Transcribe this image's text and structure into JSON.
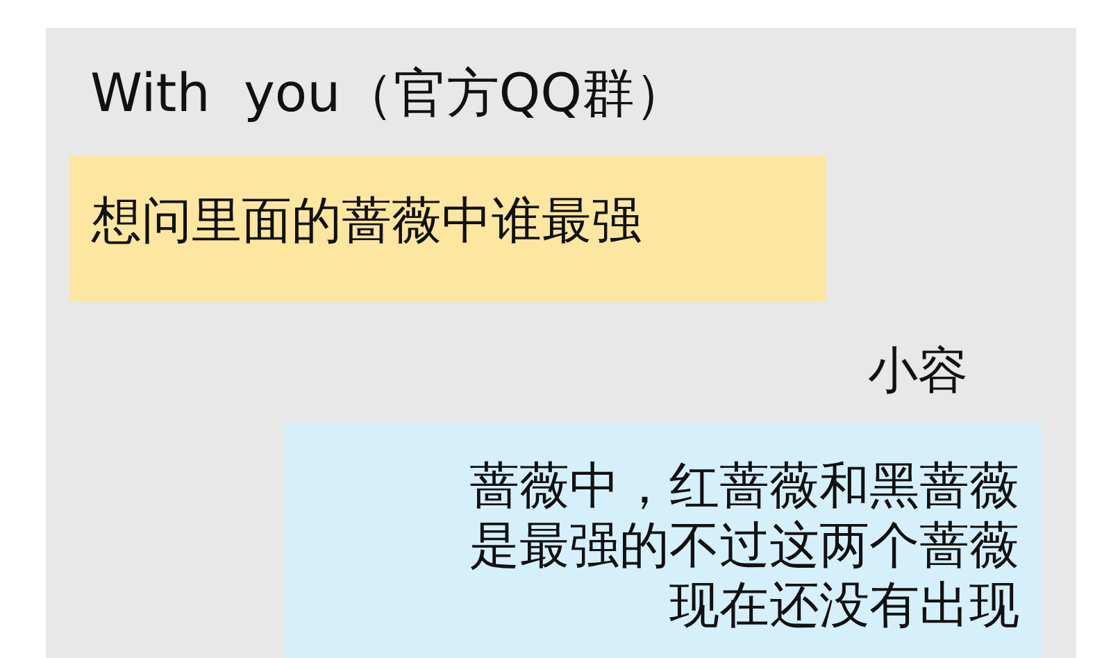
{
  "chat": {
    "title": "With  you（官方QQ群）",
    "messages": [
      {
        "kind": "incoming",
        "text": "想问里面的蔷薇中谁最强"
      },
      {
        "kind": "outgoing",
        "sender": "小容",
        "lines": [
          "蔷薇中，红蔷薇和黑蔷薇",
          "是最强的不过这两个蔷薇",
          "现在还没有出现"
        ]
      }
    ]
  }
}
